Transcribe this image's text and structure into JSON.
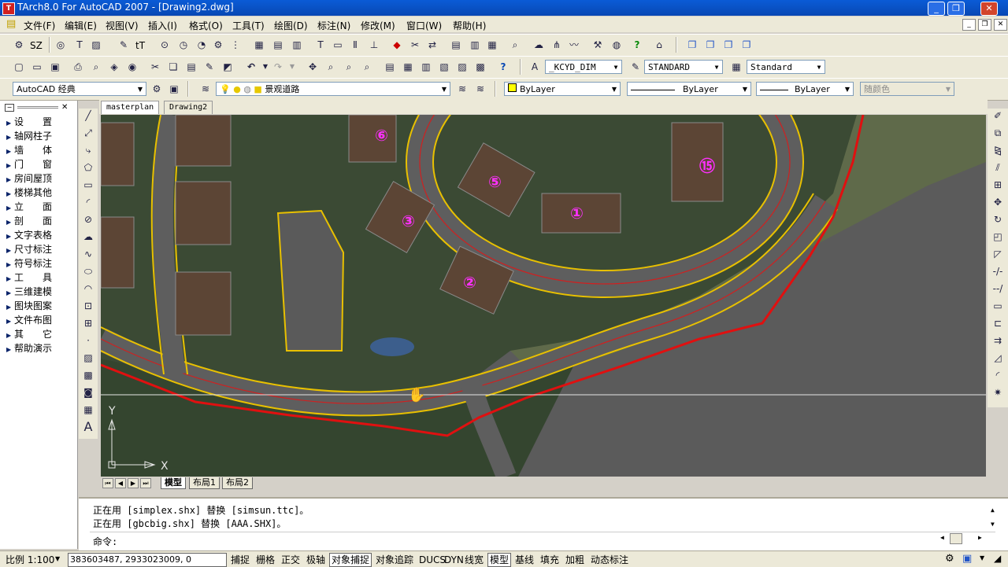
{
  "window": {
    "title": "TArch8.0 For AutoCAD 2007 - [Drawing2.dwg]",
    "app_icon": "tarch-app-icon"
  },
  "menu": {
    "items": [
      "文件(F)",
      "编辑(E)",
      "视图(V)",
      "插入(I)",
      "格式(O)",
      "工具(T)",
      "绘图(D)",
      "标注(N)",
      "修改(M)",
      "窗口(W)",
      "帮助(H)"
    ]
  },
  "toolbar1": {
    "sz_label": "SZ",
    "tt_label": "tT"
  },
  "toolbar2": {
    "dimstyle": "_KCYD_DIM",
    "textstyle": "STANDARD",
    "tablestyle": "Standard"
  },
  "toolbar3": {
    "workspace": "AutoCAD 经典",
    "layer": "景观道路",
    "color": "ByLayer",
    "linetype": "ByLayer",
    "lineweight": "ByLayer",
    "plotstyle": "随颜色"
  },
  "leftpanel": {
    "items": [
      "设　　置",
      "轴网柱子",
      "墙　　体",
      "门　　窗",
      "房间屋顶",
      "楼梯其他",
      "立　　面",
      "剖　　面",
      "文字表格",
      "尺寸标注",
      "符号标注",
      "工　　具",
      "三维建模",
      "图块图案",
      "文件布图",
      "其　　它",
      "帮助演示"
    ]
  },
  "doctabs": [
    "masterplan",
    "Drawing2"
  ],
  "canvas": {
    "ucs_x": "X",
    "ucs_y": "Y",
    "building_labels": [
      "⑥",
      "⑤",
      "③",
      "②",
      "①",
      "⑮"
    ],
    "accent_road": "#ffd800",
    "accent_boundary": "#e01010",
    "accent_label": "#ff30ff"
  },
  "layouttabs": [
    "模型",
    "布局1",
    "布局2"
  ],
  "command": {
    "line1": "正在用 [simplex.shx] 替换 [simsun.ttc]。",
    "line2": "正在用 [gbcbig.shx] 替换 [AAA.SHX]。",
    "prompt": "命令:"
  },
  "status": {
    "scale": "比例 1:100",
    "coords": "383603487, 2933023009, 0",
    "toggles": [
      "捕捉",
      "栅格",
      "正交",
      "极轴",
      "对象捕捉",
      "对象追踪",
      "DUCS",
      "DYN",
      "线宽",
      "模型",
      "基线",
      "填充",
      "加粗",
      "动态标注"
    ]
  }
}
